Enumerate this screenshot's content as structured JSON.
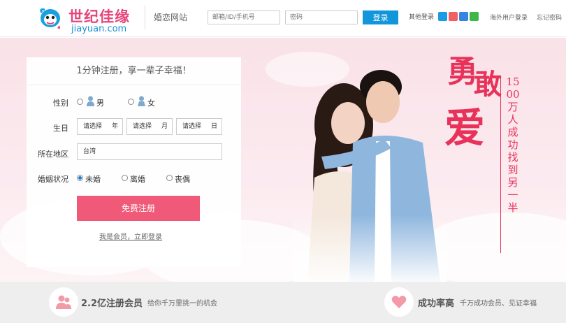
{
  "header": {
    "logo_cn": "世纪佳缘",
    "logo_en": "jiayuan.com",
    "site_sub": "婚恋网站",
    "username_placeholder": "邮箱/ID/手机号",
    "password_placeholder": "密码",
    "login_label": "登录",
    "other_login": "其他登录",
    "overseas_login": "海外用户登录",
    "forgot_password": "忘记密码"
  },
  "form": {
    "title": "1分钟注册，享一辈子幸福！",
    "gender_label": "性别",
    "male": "男",
    "female": "女",
    "birthday_label": "生日",
    "year_select": "请选择",
    "year_unit": "年",
    "month_select": "请选择",
    "month_unit": "月",
    "day_select": "请选择",
    "day_unit": "日",
    "region_label": "所在地区",
    "region_value": "台湾",
    "marital_label": "婚姻状况",
    "marital_options": [
      "未婚",
      "离婚",
      "丧偶"
    ],
    "marital_selected": "未婚",
    "register_button": "免费注册",
    "member_link": "我是会员，立即登录"
  },
  "slogan": {
    "char1": "勇",
    "char2": "敢",
    "char3": "爱",
    "vertical": "1500万人成功找到另一半"
  },
  "features": [
    {
      "title": "2.2亿注册会员",
      "desc": "给你千万里挑一的机会",
      "icon": "people-icon"
    },
    {
      "title": "成功率高",
      "desc": "千万成功会员、见证幸福",
      "icon": "heart-icon"
    }
  ],
  "colors": {
    "brand_pink": "#e8325a",
    "button_pink": "#f05a78",
    "login_blue": "#1296db"
  }
}
